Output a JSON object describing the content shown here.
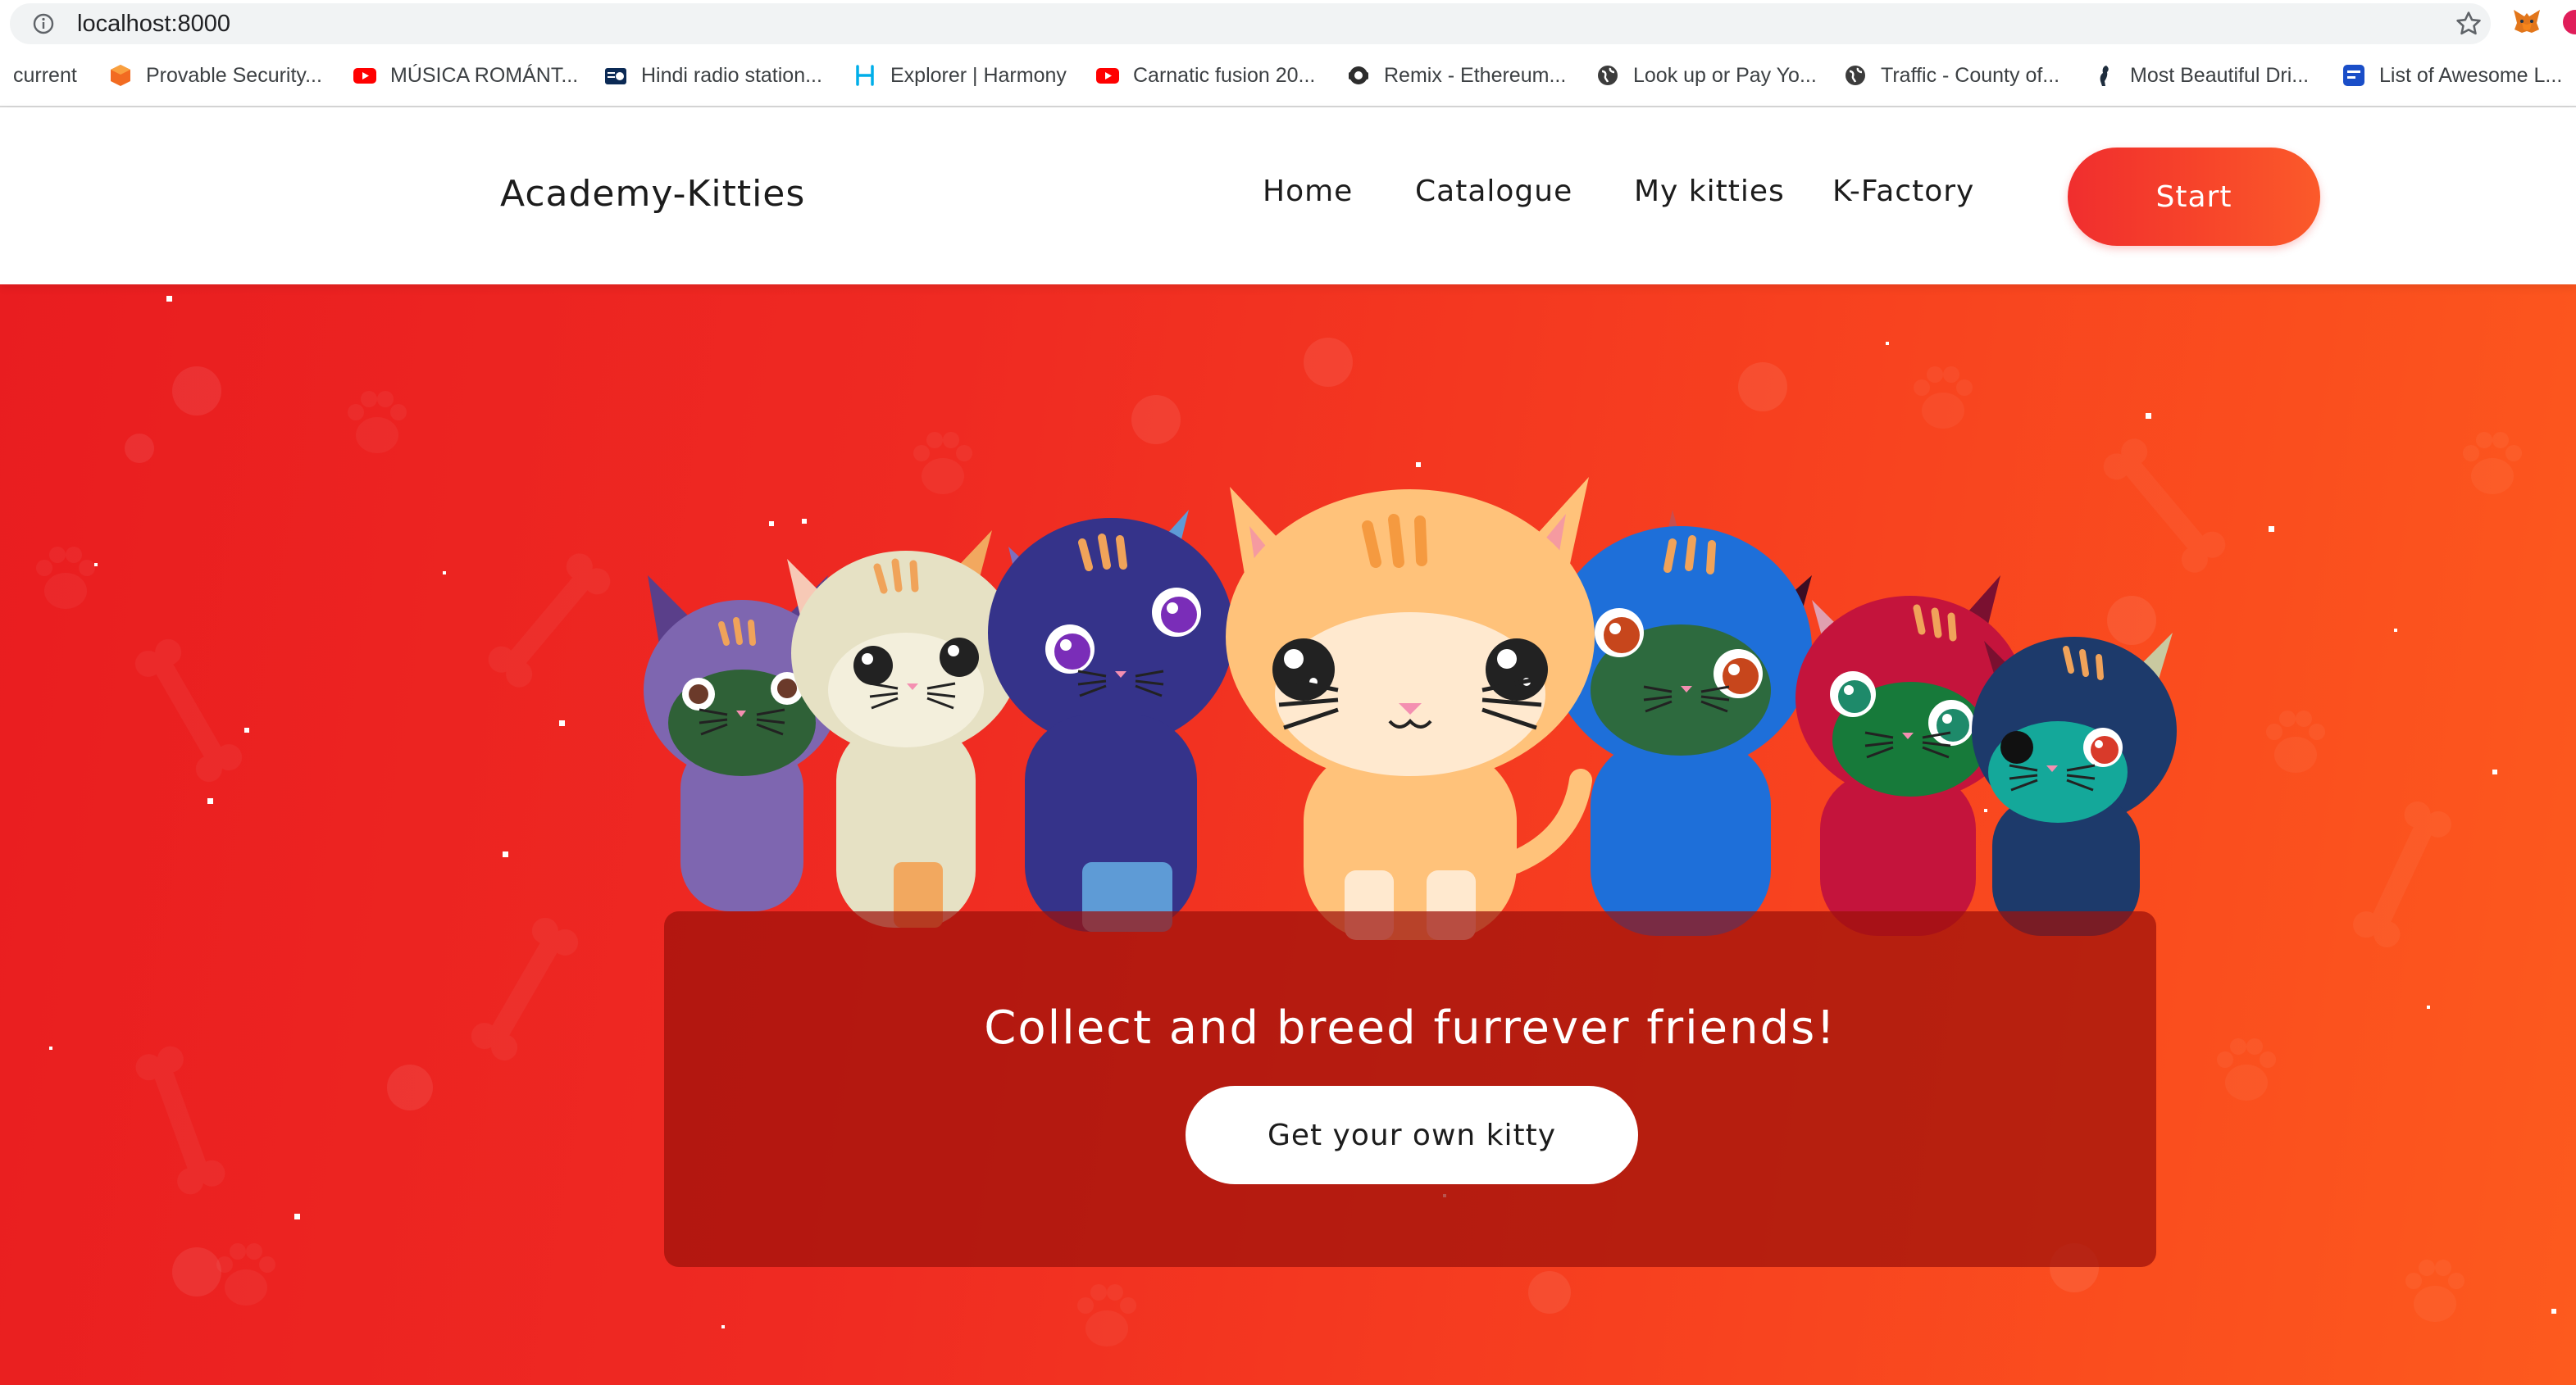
{
  "browser": {
    "url": "localhost:8000",
    "bookmarks": [
      {
        "label": "current",
        "icon": "folder-icon"
      },
      {
        "label": "Provable Security...",
        "icon": "cube-icon"
      },
      {
        "label": "MÚSICA ROMÁNT...",
        "icon": "youtube-icon"
      },
      {
        "label": "Hindi radio station...",
        "icon": "radio-icon"
      },
      {
        "label": "Explorer | Harmony",
        "icon": "harmony-icon"
      },
      {
        "label": "Carnatic fusion 20...",
        "icon": "youtube-icon"
      },
      {
        "label": "Remix - Ethereum...",
        "icon": "remix-icon"
      },
      {
        "label": "Look up or Pay Yo...",
        "icon": "globe-icon"
      },
      {
        "label": "Traffic - County of...",
        "icon": "globe-icon"
      },
      {
        "label": "Most Beautiful Dri...",
        "icon": "silhouette-icon"
      },
      {
        "label": "List of Awesome L...",
        "icon": "block-icon"
      }
    ]
  },
  "header": {
    "logo": "Academy-Kitties",
    "nav": [
      "Home",
      "Catalogue",
      "My kitties",
      "K-Factory"
    ],
    "start_label": "Start"
  },
  "hero": {
    "tagline": "Collect and breed furrever friends!",
    "cta_label": "Get your own kitty"
  },
  "colors": {
    "accent": "#f02e2e",
    "hero_gradient_start": "#e91d20",
    "hero_gradient_end": "#fd5a1e",
    "overlay": "#9c100a"
  }
}
